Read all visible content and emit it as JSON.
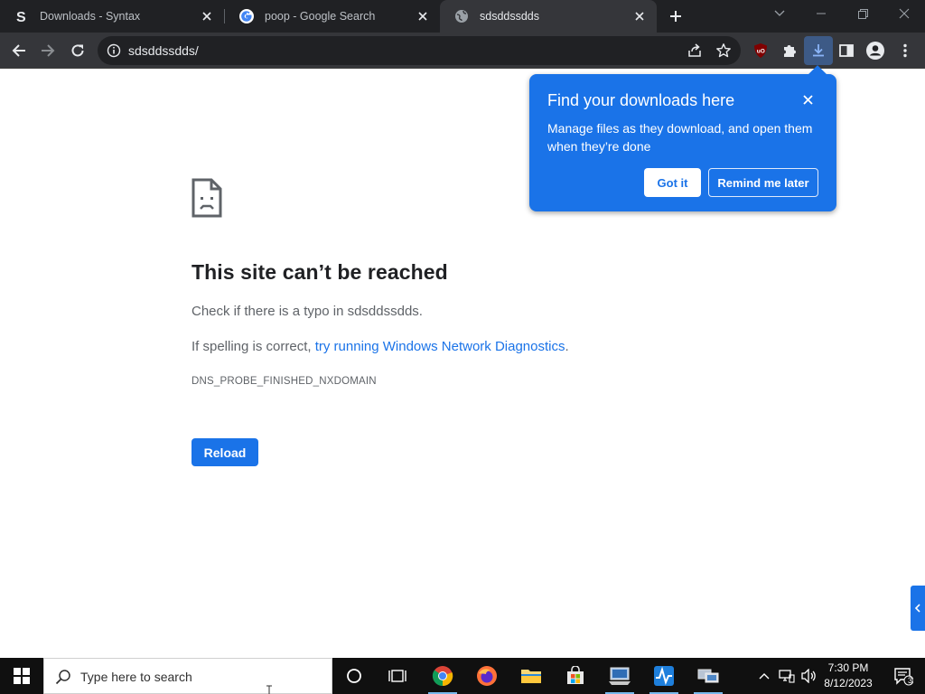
{
  "tabs": [
    {
      "title": "Downloads - Syntax",
      "favicon": "syntax-s-icon",
      "active": false
    },
    {
      "title": "poop - Google Search",
      "favicon": "google-icon",
      "active": false
    },
    {
      "title": "sdsddssdds",
      "favicon": "globe-icon",
      "active": true
    }
  ],
  "omnibox": {
    "url": "sdsddssdds/"
  },
  "error": {
    "title": "This site can’t be reached",
    "line1": "Check if there is a typo in sdsddssdds.",
    "line2_prefix": "If spelling is correct, ",
    "line2_link": "try running Windows Network Diagnostics",
    "line2_suffix": ".",
    "code": "DNS_PROBE_FINISHED_NXDOMAIN",
    "reload_label": "Reload"
  },
  "download_bubble": {
    "title": "Find your downloads here",
    "body": "Manage files as they download, and open them when they’re done",
    "got_it": "Got it",
    "remind_later": "Remind me later"
  },
  "taskbar": {
    "search_placeholder": "Type here to search",
    "time": "7:30 PM",
    "date": "8/12/2023",
    "notification_count": "3"
  },
  "colors": {
    "accent": "#1a73e8",
    "tabstrip": "#202124",
    "toolbar": "#35363a",
    "ublock": "#800000"
  }
}
